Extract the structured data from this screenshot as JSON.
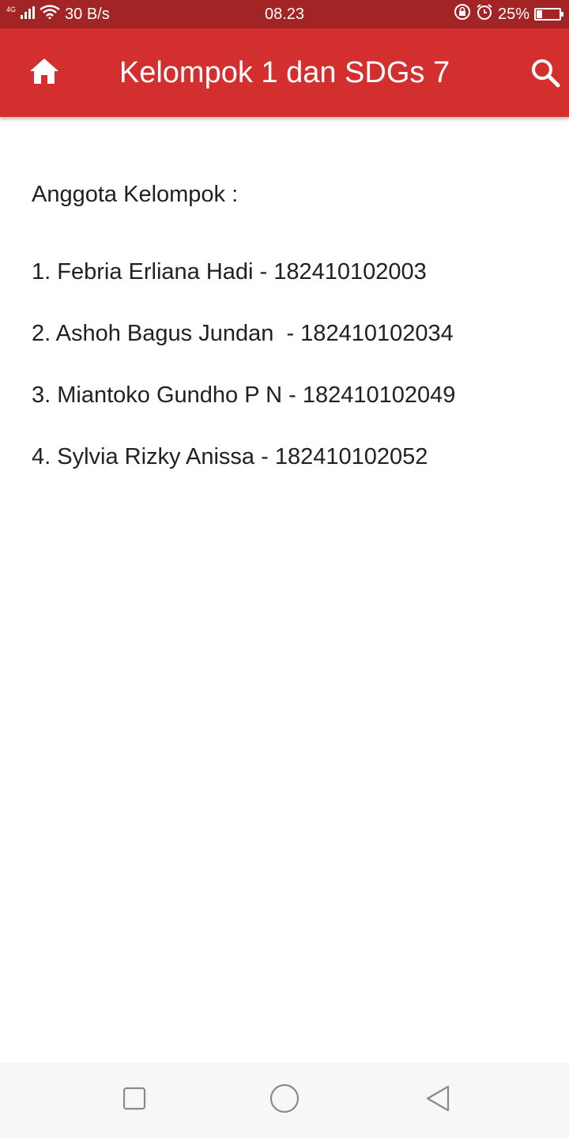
{
  "status_bar": {
    "network": "4G",
    "speed": "30 B/s",
    "time": "08.23",
    "battery": "25%",
    "battery_level": 0.25,
    "icons": [
      "signal-icon",
      "wifi-icon",
      "rotation-lock-icon",
      "alarm-icon",
      "battery-icon"
    ]
  },
  "app_bar": {
    "title": "Kelompok 1 dan SDGs 7",
    "background": "#d32f2f",
    "icons": [
      "home-icon",
      "search-icon"
    ]
  },
  "content": {
    "heading": "Anggota Kelompok :",
    "members": [
      "1. Febria Erliana Hadi - 182410102003",
      "2. Ashoh Bagus Jundan  - 182410102034",
      "3. Miantoko Gundho P N - 182410102049",
      "4. Sylvia Rizky Anissa - 182410102052"
    ]
  },
  "nav_bar": {
    "icons": [
      "recent-apps-icon",
      "home-circle-icon",
      "back-triangle-icon"
    ]
  }
}
